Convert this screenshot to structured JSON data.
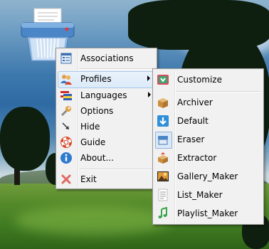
{
  "desktop": {
    "icon": "shredder-icon"
  },
  "main_menu": {
    "items": [
      {
        "label": "Associations",
        "icon": "associations-icon"
      },
      {
        "label": "Profiles",
        "icon": "profiles-icon",
        "has_submenu": true,
        "highlighted": true
      },
      {
        "label": "Languages",
        "icon": "languages-flag-icon",
        "has_submenu": true
      },
      {
        "label": "Options",
        "icon": "wrench-icon"
      },
      {
        "label": "Hide",
        "icon": "hide-arrow-icon"
      },
      {
        "label": "Guide",
        "icon": "lifebuoy-icon"
      },
      {
        "label": "About...",
        "icon": "info-icon"
      },
      {
        "label": "Exit",
        "icon": "exit-x-icon"
      }
    ]
  },
  "profiles_submenu": {
    "items": [
      {
        "label": "Customize",
        "icon": "customize-icon"
      },
      {
        "label": "Archiver",
        "icon": "archiver-box-icon"
      },
      {
        "label": "Default",
        "icon": "default-arrow-icon"
      },
      {
        "label": "Eraser",
        "icon": "eraser-icon",
        "selected": true
      },
      {
        "label": "Extractor",
        "icon": "extractor-box-icon"
      },
      {
        "label": "Gallery_Maker",
        "icon": "gallery-picture-icon"
      },
      {
        "label": "List_Maker",
        "icon": "list-document-icon"
      },
      {
        "label": "Playlist_Maker",
        "icon": "music-note-icon"
      }
    ]
  }
}
